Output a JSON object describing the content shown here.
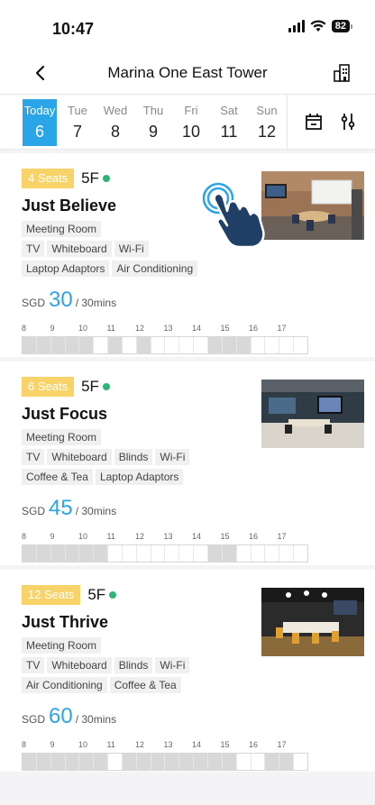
{
  "status": {
    "time": "10:47",
    "battery": "82"
  },
  "nav": {
    "title": "Marina One East Tower"
  },
  "dates": [
    {
      "name": "Today",
      "num": "6",
      "selected": true
    },
    {
      "name": "Tue",
      "num": "7"
    },
    {
      "name": "Wed",
      "num": "8"
    },
    {
      "name": "Thu",
      "num": "9"
    },
    {
      "name": "Fri",
      "num": "10"
    },
    {
      "name": "Sat",
      "num": "11"
    },
    {
      "name": "Sun",
      "num": "12"
    }
  ],
  "hours": [
    "8",
    "9",
    "10",
    "11",
    "12",
    "13",
    "14",
    "15",
    "16",
    "17"
  ],
  "rooms": [
    {
      "seats": "4 Seats",
      "floor": "5F",
      "name": "Just Believe",
      "tags": [
        "Meeting Room",
        "TV",
        "Whiteboard",
        "Wi-Fi",
        "Laptop Adaptors",
        "Air Conditioning"
      ],
      "currency": "SGD",
      "price": "30",
      "unit": "/ 30mins",
      "booked_slots": [
        0,
        1,
        2,
        3,
        4,
        6,
        8,
        13,
        14,
        15
      ]
    },
    {
      "seats": "6 Seats",
      "floor": "5F",
      "name": "Just Focus",
      "tags": [
        "Meeting Room",
        "TV",
        "Whiteboard",
        "Blinds",
        "Wi-Fi",
        "Coffee & Tea",
        "Laptop Adaptors"
      ],
      "currency": "SGD",
      "price": "45",
      "unit": "/ 30mins",
      "booked_slots": [
        0,
        1,
        2,
        3,
        4,
        5,
        13,
        14
      ]
    },
    {
      "seats": "12 Seats",
      "floor": "5F",
      "name": "Just Thrive",
      "tags": [
        "Meeting Room",
        "TV",
        "Whiteboard",
        "Blinds",
        "Wi-Fi",
        "Air Conditioning",
        "Coffee & Tea"
      ],
      "currency": "SGD",
      "price": "60",
      "unit": "/ 30mins",
      "booked_slots": [
        0,
        1,
        2,
        3,
        4,
        5,
        7,
        8,
        9,
        10,
        11,
        12,
        13,
        14,
        17,
        18
      ]
    }
  ],
  "colors": {
    "accent": "#2aa5e8",
    "seats_badge": "#f8d36a",
    "available_dot": "#2bb673"
  }
}
